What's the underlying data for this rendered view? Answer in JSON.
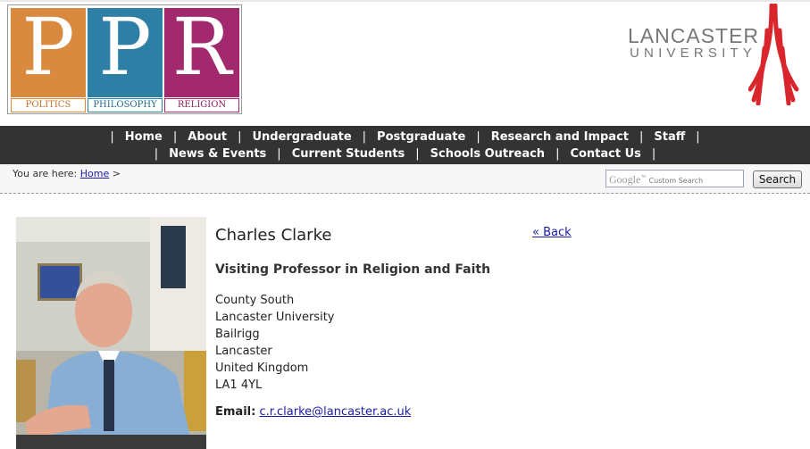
{
  "logo": {
    "tiles": [
      {
        "letter": "P",
        "caption": "POLITICS",
        "color": "#d98a3f"
      },
      {
        "letter": "P",
        "caption": "PHILOSOPHY",
        "color": "#2e7fa5"
      },
      {
        "letter": "R",
        "caption": "RELIGION",
        "color": "#a3296e"
      }
    ]
  },
  "university": {
    "line1": "LANCASTER",
    "line2": "UNIVERSITY",
    "crest_color": "#d9262c"
  },
  "nav": {
    "row1": [
      "Home",
      "About",
      "Undergraduate",
      "Postgraduate",
      "Research and Impact",
      "Staff"
    ],
    "row2": [
      "News & Events",
      "Current Students",
      "Schools Outreach",
      "Contact Us"
    ],
    "separator": "|"
  },
  "breadcrumb": {
    "prefix": "You are here:",
    "home": "Home",
    "sep": ">"
  },
  "search": {
    "google": "Google",
    "tm": "™",
    "placeholder": "Custom Search",
    "button": "Search"
  },
  "profile": {
    "name": "Charles Clarke",
    "back": "« Back",
    "role": "Visiting Professor in Religion and Faith",
    "address": [
      "County South",
      "Lancaster University",
      "Bailrigg",
      "Lancaster",
      "United Kingdom",
      "LA1 4YL"
    ],
    "email_label": "Email:",
    "email": "c.r.clarke@lancaster.ac.uk"
  }
}
